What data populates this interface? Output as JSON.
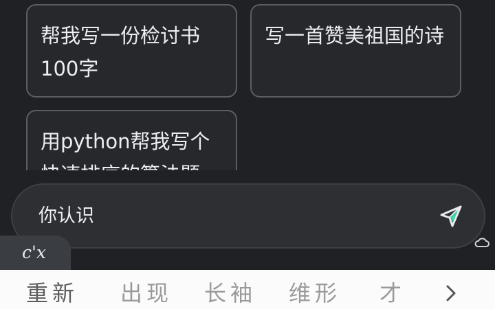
{
  "suggestions": [
    {
      "text": "帮我写一份检讨书100字"
    },
    {
      "text": "写一首赞美祖国的诗"
    },
    {
      "text": "用python帮我写个快速排序的算法题"
    }
  ],
  "input": {
    "value": "你认识"
  },
  "keyboard": {
    "pinyin": "c'x",
    "candidates": [
      "重新",
      "出现",
      "长袖",
      "维形",
      "才"
    ]
  },
  "icons": {
    "send": "send-icon",
    "more": "chevron-right-icon",
    "cloud": "cloud-icon"
  }
}
